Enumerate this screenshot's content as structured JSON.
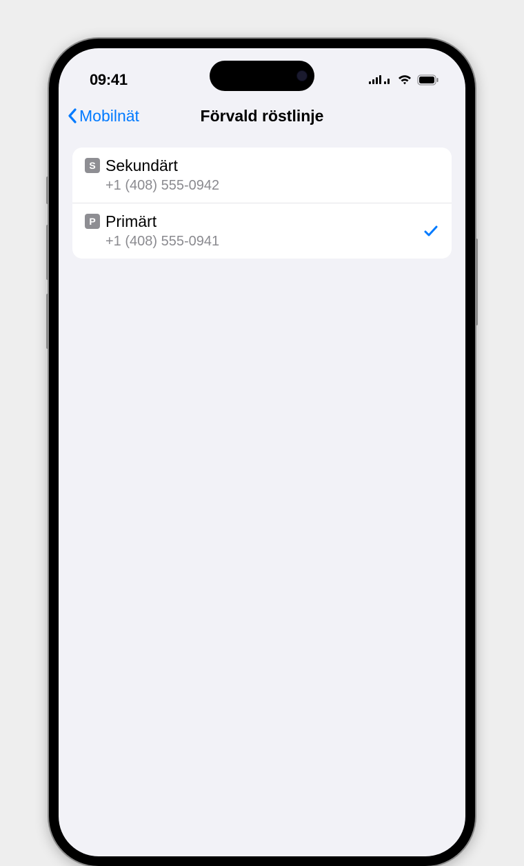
{
  "status": {
    "time": "09:41"
  },
  "nav": {
    "back_label": "Mobilnät",
    "title": "Förvald röstlinje"
  },
  "lines": [
    {
      "badge": "S",
      "title": "Sekundärt",
      "subtitle": "+1 (408) 555-0942",
      "selected": false
    },
    {
      "badge": "P",
      "title": "Primärt",
      "subtitle": "+1 (408) 555-0941",
      "selected": true
    }
  ]
}
